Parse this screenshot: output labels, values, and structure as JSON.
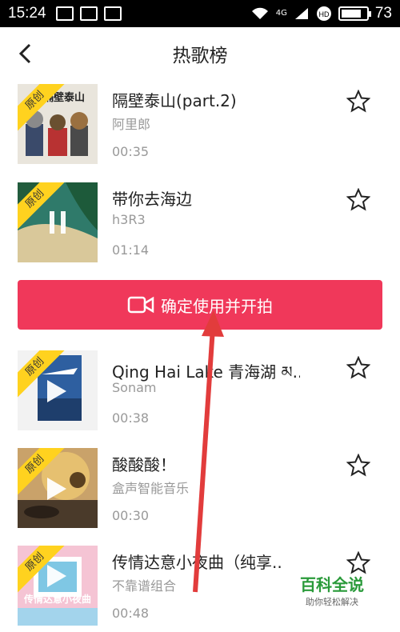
{
  "status_bar": {
    "time": "15:24",
    "network": "4G",
    "battery": "73"
  },
  "header": {
    "title": "热歌榜"
  },
  "ribbon_label": "原创",
  "songs": [
    {
      "title": "隔壁泰山(part.2)",
      "artist": "阿里郎",
      "duration": "00:35",
      "cover_text": "隔壁泰山",
      "state": "none"
    },
    {
      "title": "带你去海边",
      "artist": "h3R3",
      "duration": "01:14",
      "state": "pause"
    },
    {
      "title": "Qing Hai Lake 青海湖 མ..",
      "artist": "Sonam",
      "duration": "00:38",
      "state": "play"
    },
    {
      "title": "酸酸酸！",
      "artist": "盒声智能音乐",
      "duration": "00:30",
      "state": "play"
    },
    {
      "title": "传情达意小夜曲（纯享..",
      "artist": "不靠谱组合",
      "duration": "00:48",
      "cover_text": "传情达意小夜曲",
      "state": "play"
    }
  ],
  "confirm_button": {
    "label": "确定使用并开拍"
  },
  "watermark": {
    "main": "百科全说",
    "sub": "助你轻松解决"
  },
  "colors": {
    "accent": "#f0385a",
    "ribbon": "#ffd21f",
    "annotation_arrow": "#e23c3c"
  }
}
